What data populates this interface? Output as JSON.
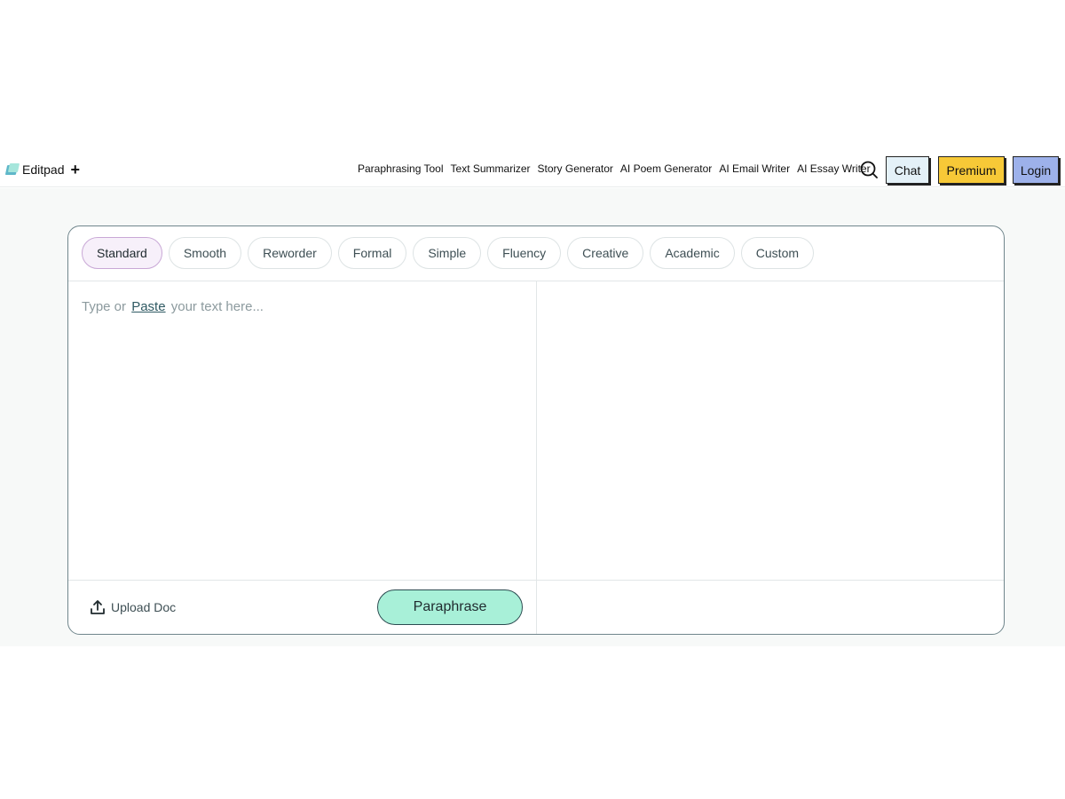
{
  "brand": {
    "name": "Editpad",
    "plus": "+"
  },
  "nav": {
    "links": [
      "Paraphrasing Tool",
      "Text Summarizer",
      "Story Generator",
      "AI Poem Generator",
      "AI Email Writer",
      "AI Essay Writer"
    ]
  },
  "header_buttons": {
    "chat": "Chat",
    "premium": "Premium",
    "login": "Login"
  },
  "modes": {
    "items": [
      "Standard",
      "Smooth",
      "Reworder",
      "Formal",
      "Simple",
      "Fluency",
      "Creative",
      "Academic",
      "Custom"
    ],
    "selected": "Standard"
  },
  "editor": {
    "placeholder_before": "Type or",
    "paste_link": "Paste",
    "placeholder_after": "your text here..."
  },
  "actions": {
    "upload": "Upload Doc",
    "paraphrase": "Paraphrase"
  },
  "colors": {
    "chat_bg": "#e4f1f8",
    "premium_bg": "#f7c937",
    "login_bg": "#9db1ea",
    "paraphrase_bg": "#a8f0d8",
    "active_mode_bg": "#f7f0fa"
  }
}
